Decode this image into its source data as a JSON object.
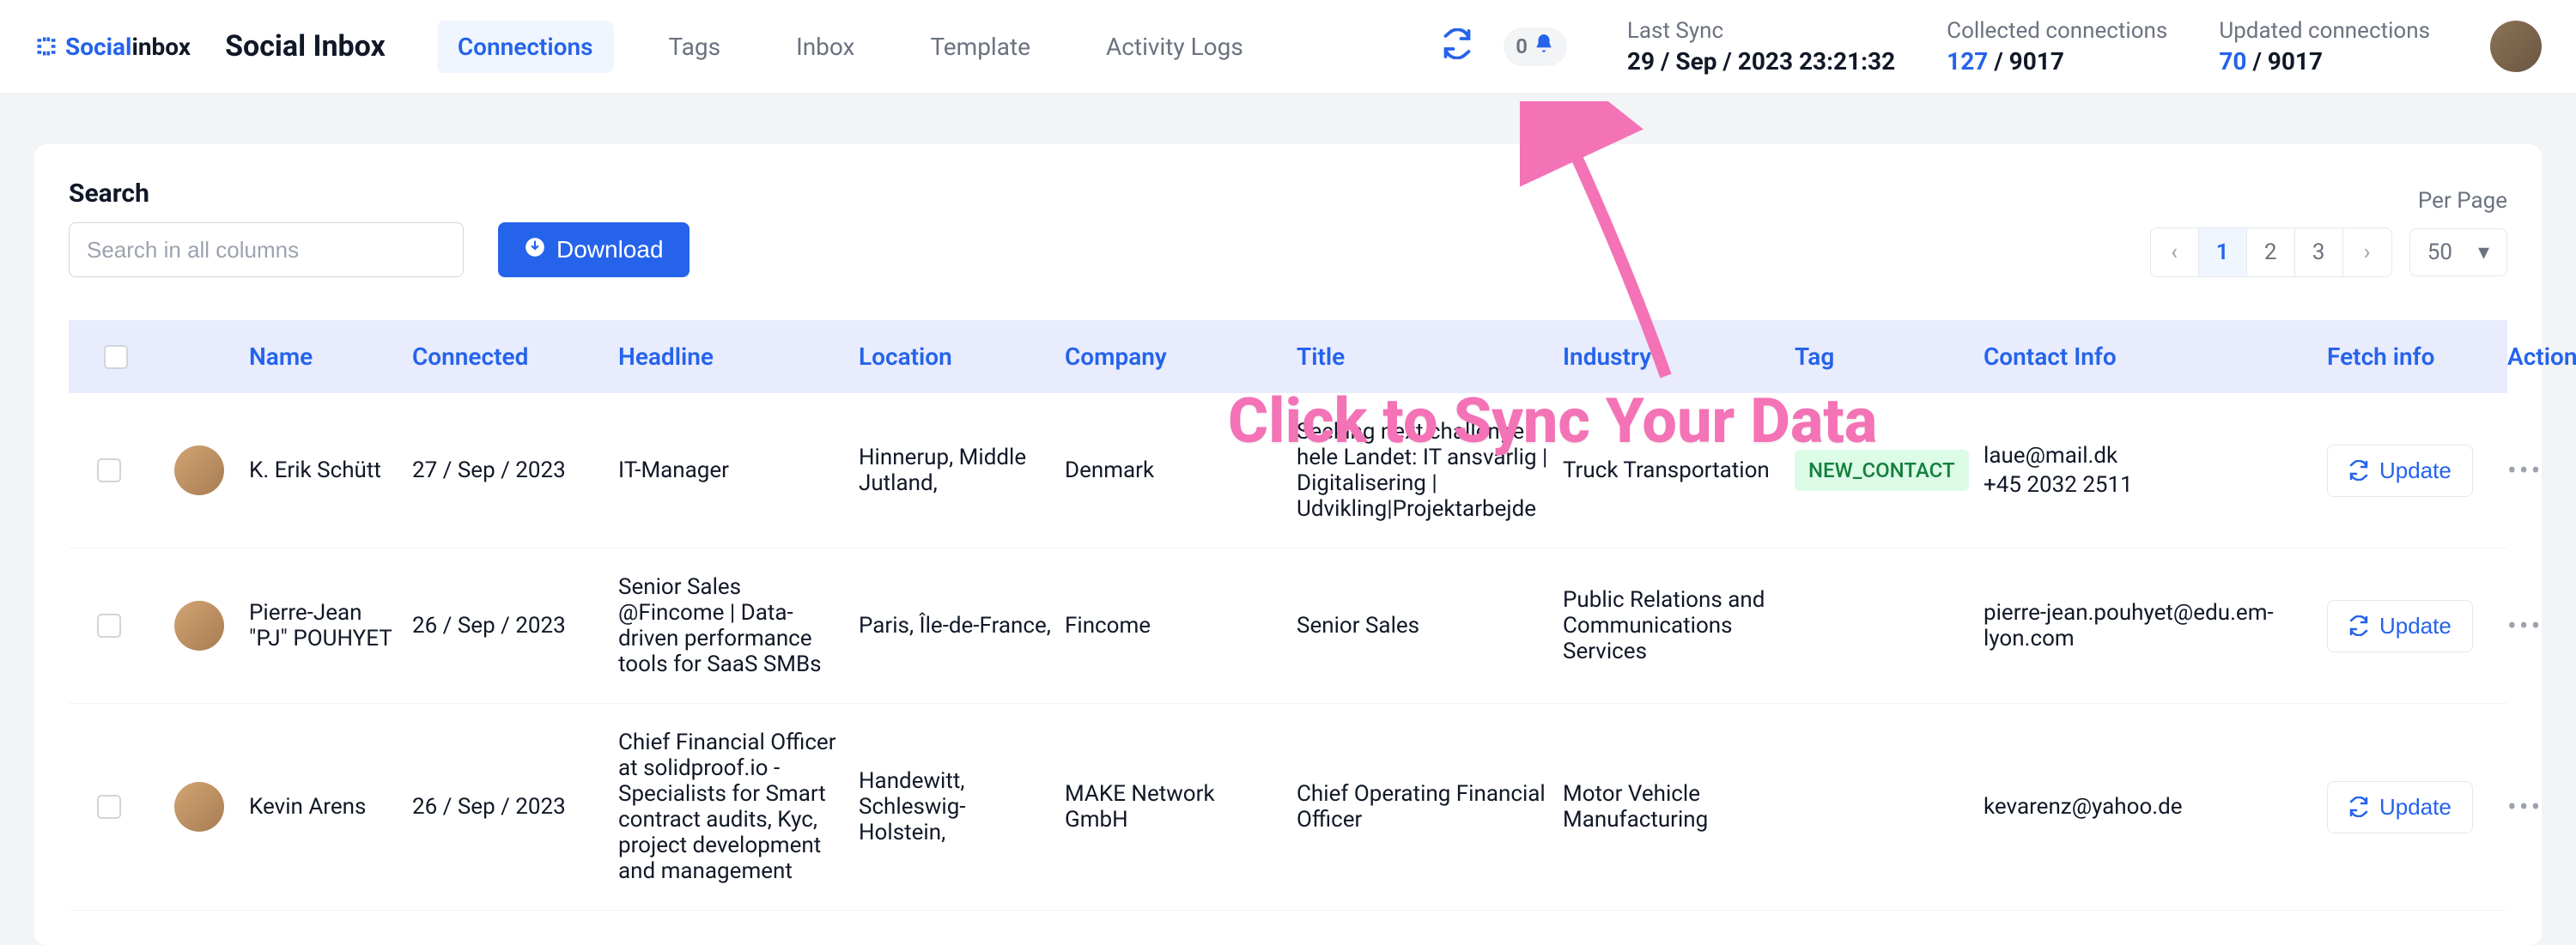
{
  "logo": {
    "brand_prefix": "Social",
    "brand_suffix": "inbox"
  },
  "brand_title": "Social Inbox",
  "nav": {
    "connections": "Connections",
    "tags": "Tags",
    "inbox": "Inbox",
    "template": "Template",
    "activity_logs": "Activity Logs"
  },
  "notif_count": "0",
  "stats": {
    "last_sync_label": "Last Sync",
    "last_sync_value": "29 / Sep / 2023 23:21:32",
    "collected_label": "Collected connections",
    "collected_accent": "127",
    "collected_rest": " / 9017",
    "updated_label": "Updated connections",
    "updated_accent": "70",
    "updated_rest": " / 9017"
  },
  "search": {
    "label": "Search",
    "placeholder": "Search in all columns"
  },
  "download_label": "Download",
  "perpage_label": "Per Page",
  "perpage_value": "50",
  "pages": {
    "p1": "1",
    "p2": "2",
    "p3": "3"
  },
  "columns": {
    "name": "Name",
    "connected": "Connected",
    "headline": "Headline",
    "location": "Location",
    "company": "Company",
    "title": "Title",
    "industry": "Industry",
    "tag": "Tag",
    "contact": "Contact Info",
    "fetch": "Fetch info",
    "actions": "Actions"
  },
  "update_label": "Update",
  "annotation_text": "Click to Sync Your Data",
  "rows": [
    {
      "name": "K. Erik Schütt",
      "connected": "27 / Sep / 2023",
      "headline": "IT-Manager",
      "location": "Hinnerup, Middle Jutland,",
      "company": "Denmark",
      "title": "Seeking next challenge hele Landet: IT ansvarlig | Digitalisering | Udvikling|Projektarbejde",
      "industry": "Truck Transportation",
      "tag": "NEW_CONTACT",
      "email": "laue@mail.dk",
      "phone": "+45 2032 2511"
    },
    {
      "name": "Pierre-Jean \"PJ\" POUHYET",
      "connected": "26 / Sep / 2023",
      "headline": "Senior Sales @Fincome | Data-driven performance tools for SaaS SMBs",
      "location": "Paris, Île-de-France,",
      "company": "Fincome",
      "title": "Senior Sales",
      "industry": "Public Relations and Communications Services",
      "tag": "",
      "email": "pierre-jean.pouhyet@edu.em-lyon.com",
      "phone": ""
    },
    {
      "name": "Kevin Arens",
      "connected": "26 / Sep / 2023",
      "headline": "Chief Financial Officer at solidproof.io - Specialists for Smart contract audits, Kyc, project development and management",
      "location": "Handewitt, Schleswig-Holstein,",
      "company": "MAKE Network GmbH",
      "title": "Chief Operating Financial Officer",
      "industry": "Motor Vehicle Manufacturing",
      "tag": "",
      "email": "kevarenz@yahoo.de",
      "phone": ""
    }
  ]
}
